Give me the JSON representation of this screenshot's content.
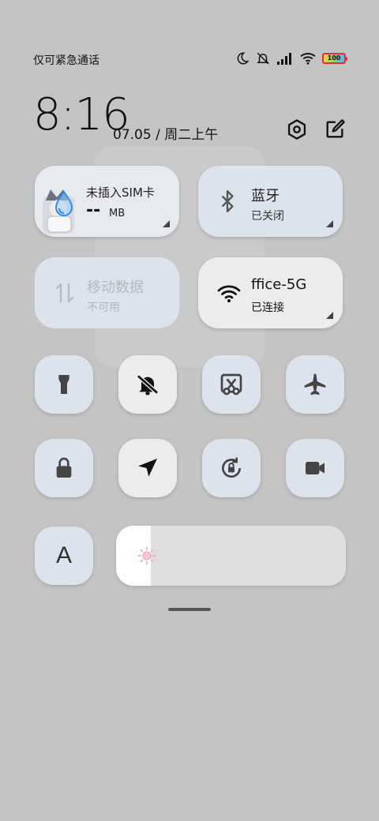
{
  "status_bar": {
    "carrier": "仅可紧急通话",
    "battery": "100",
    "icons": [
      "moon-icon",
      "mute-icon",
      "signal-icon",
      "wifi-icon",
      "battery-icon"
    ]
  },
  "header": {
    "time": "8:16",
    "date": "07.05 / 周二上午",
    "icons": [
      "settings-icon",
      "edit-icon"
    ]
  },
  "tiles": {
    "sim": {
      "title": "未插入SIM卡",
      "value": "--",
      "unit": "MB"
    },
    "bluetooth": {
      "title": "蓝牙",
      "status": "已关闭",
      "icon": "bluetooth-icon"
    },
    "mobile_data": {
      "title": "移动数据",
      "status": "不可用",
      "icon": "data-arrows-icon"
    },
    "wifi": {
      "title": "ffice-5G",
      "status": "已连接",
      "icon": "wifi-icon"
    }
  },
  "toggles": [
    {
      "name": "flashlight",
      "icon": "flashlight-icon",
      "active": false
    },
    {
      "name": "mute",
      "icon": "bell-off-icon",
      "active": true
    },
    {
      "name": "screenshot",
      "icon": "scissors-icon",
      "active": false
    },
    {
      "name": "airplane",
      "icon": "airplane-icon",
      "active": false
    },
    {
      "name": "lock-screen",
      "icon": "lock-icon",
      "active": false
    },
    {
      "name": "location",
      "icon": "location-arrow-icon",
      "active": true
    },
    {
      "name": "rotation-lock",
      "icon": "rotation-lock-icon",
      "active": false
    },
    {
      "name": "screen-record",
      "icon": "video-camera-icon",
      "active": false
    }
  ],
  "font_tile": {
    "label": "A"
  },
  "brightness": {
    "level": 0.15,
    "icon": "sun-icon"
  },
  "colors": {
    "background": "#c4c4c4",
    "tile_inactive": "#dde3ec",
    "tile_active": "#ececec",
    "text": "#111111"
  }
}
